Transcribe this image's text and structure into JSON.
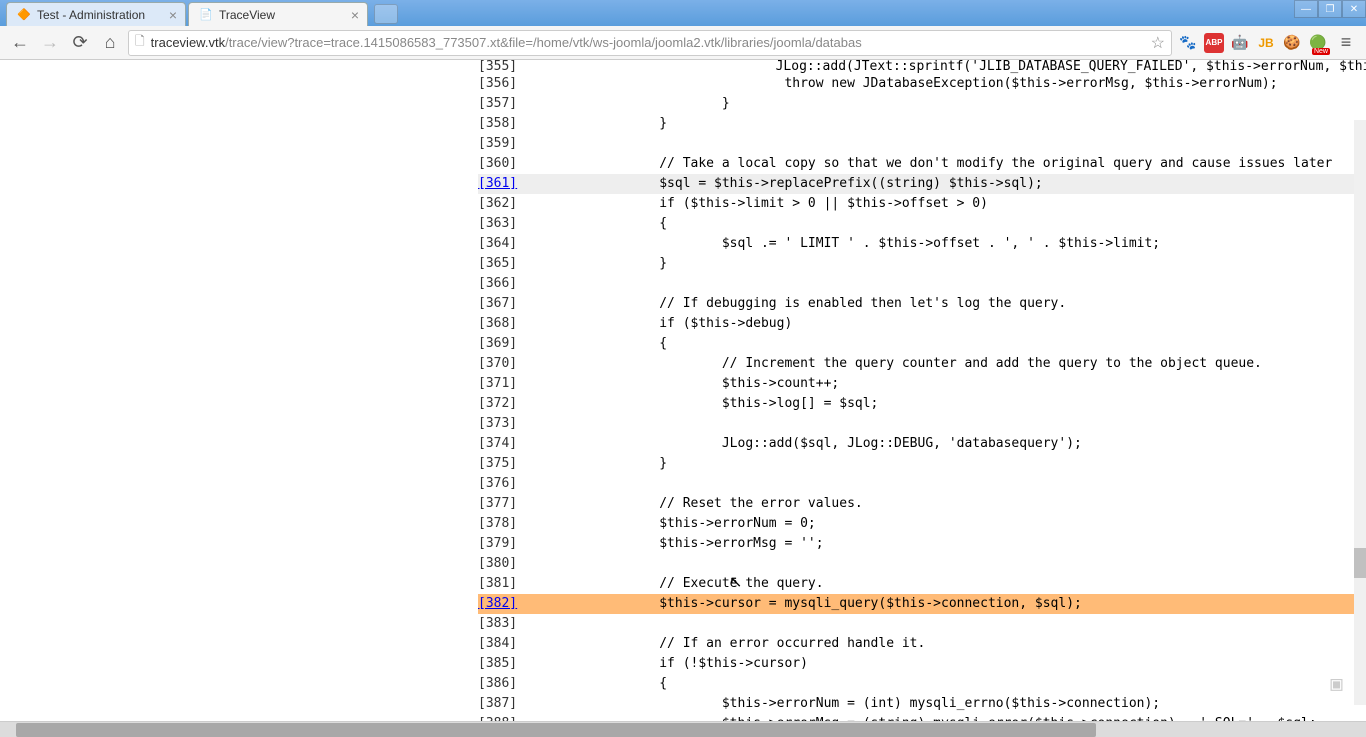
{
  "tabs": [
    {
      "title": "Test - Administration",
      "favicon": "🔶",
      "active": false
    },
    {
      "title": "TraceView",
      "favicon": "📄",
      "active": true
    }
  ],
  "url": {
    "host": "traceview.vtk",
    "path": "/trace/view?trace=trace.1415086583_773507.xt&file=/home/vtk/ws-joomla/joomla2.vtk/libraries/joomla/databas"
  },
  "extensions": [
    "🐾",
    "ABP",
    "🤖",
    "JB",
    "🍪",
    "🔴"
  ],
  "code_lines": [
    {
      "num": "[355]",
      "text": "                                JLog::add(JText::sprintf('JLIB_DATABASE_QUERY_FAILED', $this->errorNum, $this",
      "link": false,
      "hl": "cut"
    },
    {
      "num": "[356]",
      "text": "                                throw new JDatabaseException($this->errorMsg, $this->errorNum);",
      "link": false,
      "hl": ""
    },
    {
      "num": "[357]",
      "text": "                        }",
      "link": false,
      "hl": ""
    },
    {
      "num": "[358]",
      "text": "                }",
      "link": false,
      "hl": ""
    },
    {
      "num": "[359]",
      "text": "",
      "link": false,
      "hl": ""
    },
    {
      "num": "[360]",
      "text": "                // Take a local copy so that we don't modify the original query and cause issues later",
      "link": false,
      "hl": ""
    },
    {
      "num": "[361]",
      "text": "                $sql = $this->replacePrefix((string) $this->sql);",
      "link": true,
      "hl": "gray"
    },
    {
      "num": "[362]",
      "text": "                if ($this->limit > 0 || $this->offset > 0)",
      "link": false,
      "hl": ""
    },
    {
      "num": "[363]",
      "text": "                {",
      "link": false,
      "hl": ""
    },
    {
      "num": "[364]",
      "text": "                        $sql .= ' LIMIT ' . $this->offset . ', ' . $this->limit;",
      "link": false,
      "hl": ""
    },
    {
      "num": "[365]",
      "text": "                }",
      "link": false,
      "hl": ""
    },
    {
      "num": "[366]",
      "text": "",
      "link": false,
      "hl": ""
    },
    {
      "num": "[367]",
      "text": "                // If debugging is enabled then let's log the query.",
      "link": false,
      "hl": ""
    },
    {
      "num": "[368]",
      "text": "                if ($this->debug)",
      "link": false,
      "hl": ""
    },
    {
      "num": "[369]",
      "text": "                {",
      "link": false,
      "hl": ""
    },
    {
      "num": "[370]",
      "text": "                        // Increment the query counter and add the query to the object queue.",
      "link": false,
      "hl": ""
    },
    {
      "num": "[371]",
      "text": "                        $this->count++;",
      "link": false,
      "hl": ""
    },
    {
      "num": "[372]",
      "text": "                        $this->log[] = $sql;",
      "link": false,
      "hl": ""
    },
    {
      "num": "[373]",
      "text": "",
      "link": false,
      "hl": ""
    },
    {
      "num": "[374]",
      "text": "                        JLog::add($sql, JLog::DEBUG, 'databasequery');",
      "link": false,
      "hl": ""
    },
    {
      "num": "[375]",
      "text": "                }",
      "link": false,
      "hl": ""
    },
    {
      "num": "[376]",
      "text": "",
      "link": false,
      "hl": ""
    },
    {
      "num": "[377]",
      "text": "                // Reset the error values.",
      "link": false,
      "hl": ""
    },
    {
      "num": "[378]",
      "text": "                $this->errorNum = 0;",
      "link": false,
      "hl": ""
    },
    {
      "num": "[379]",
      "text": "                $this->errorMsg = '';",
      "link": false,
      "hl": ""
    },
    {
      "num": "[380]",
      "text": "",
      "link": false,
      "hl": ""
    },
    {
      "num": "[381]",
      "text": "                // Execute the query.",
      "link": false,
      "hl": ""
    },
    {
      "num": "[382]",
      "text": "                $this->cursor = mysqli_query($this->connection, $sql);",
      "link": true,
      "hl": "orange"
    },
    {
      "num": "[383]",
      "text": "",
      "link": false,
      "hl": ""
    },
    {
      "num": "[384]",
      "text": "                // If an error occurred handle it.",
      "link": false,
      "hl": ""
    },
    {
      "num": "[385]",
      "text": "                if (!$this->cursor)",
      "link": false,
      "hl": ""
    },
    {
      "num": "[386]",
      "text": "                {",
      "link": false,
      "hl": ""
    },
    {
      "num": "[387]",
      "text": "                        $this->errorNum = (int) mysqli_errno($this->connection);",
      "link": false,
      "hl": ""
    },
    {
      "num": "[388]",
      "text": "                        $this->errorMsg = (string) mysqli_error($this->connection) . ' SQL=' . $sql;",
      "link": false,
      "hl": ""
    }
  ]
}
